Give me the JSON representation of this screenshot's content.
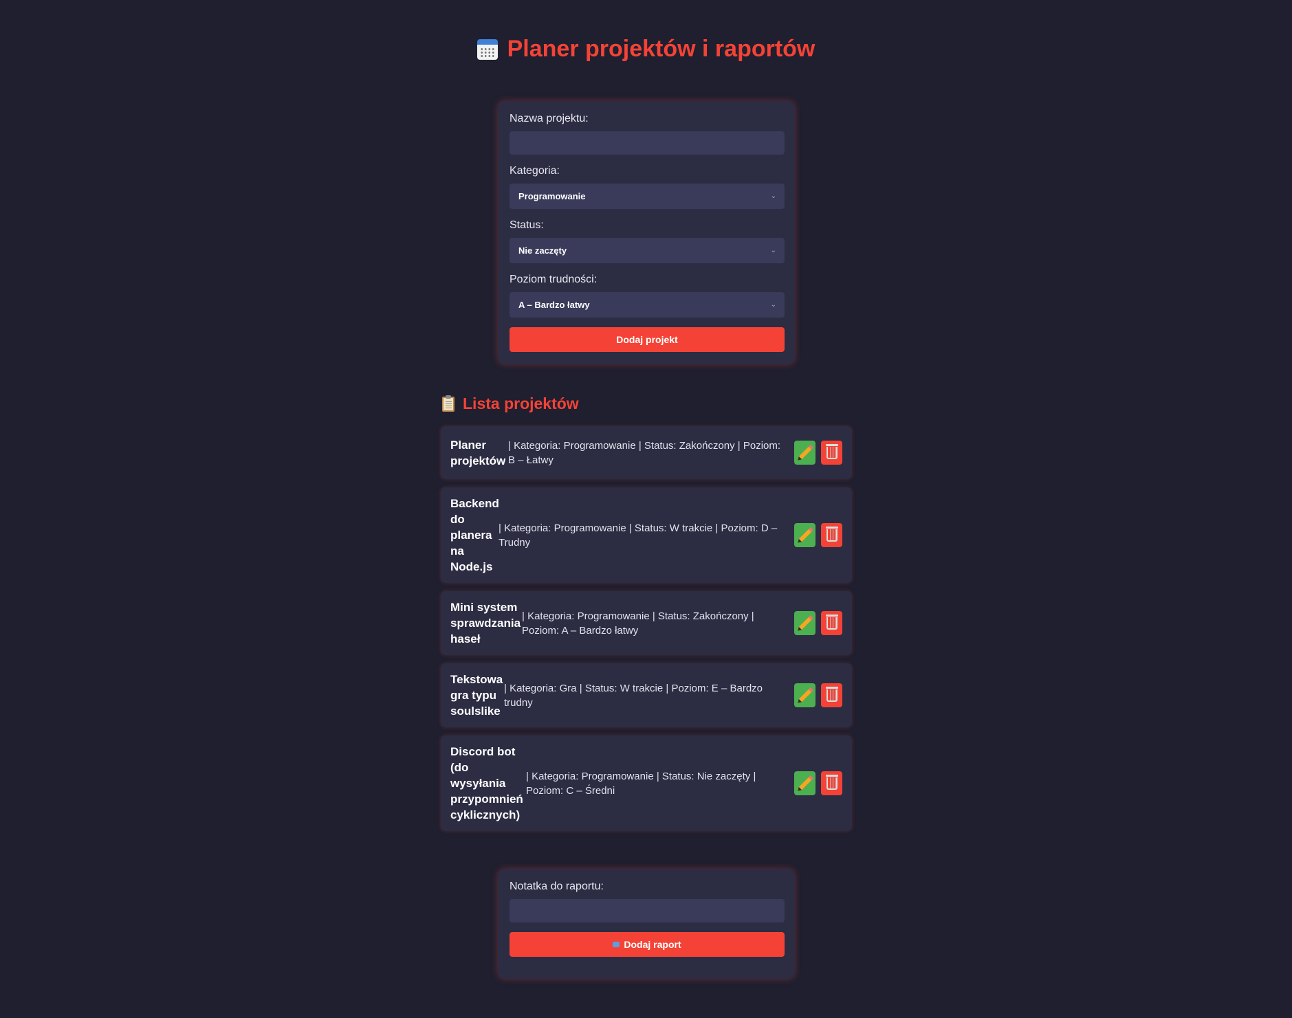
{
  "header": {
    "title": "Planer projektów i raportów",
    "icon": "calendar-icon"
  },
  "form": {
    "name_label": "Nazwa projektu:",
    "name_value": "",
    "category_label": "Kategoria:",
    "category_value": "Programowanie",
    "status_label": "Status:",
    "status_value": "Nie zaczęty",
    "difficulty_label": "Poziom trudności:",
    "difficulty_value": "A – Bardzo łatwy",
    "submit_label": "Dodaj projekt"
  },
  "list": {
    "title": "Lista projektów",
    "icon": "clipboard-icon",
    "items": [
      {
        "name": "Planer projektów",
        "info": "| Kategoria: Programowanie | Status: Zakończony | Poziom: B – Łatwy"
      },
      {
        "name": "Backend do planera na Node.js",
        "info": "| Kategoria: Programowanie | Status: W trakcie | Poziom: D – Trudny"
      },
      {
        "name": "Mini system sprawdzania haseł",
        "info": "| Kategoria: Programowanie | Status: Zakończony | Poziom: A – Bardzo łatwy"
      },
      {
        "name": "Tekstowa gra typu soulslike",
        "info": "| Kategoria: Gra | Status: W trakcie | Poziom: E – Bardzo trudny"
      },
      {
        "name": "Discord bot (do wysyłania przypomnień cyklicznych)",
        "info": "| Kategoria: Programowanie | Status: Nie zaczęty | Poziom: C – Średni"
      }
    ]
  },
  "report": {
    "note_label": "Notatka do raportu:",
    "note_value": "",
    "submit_label": "Dodaj raport"
  },
  "colors": {
    "background": "#1f1f2f",
    "card": "#2c2c43",
    "accent": "#f44336",
    "edit": "#4caf50"
  }
}
